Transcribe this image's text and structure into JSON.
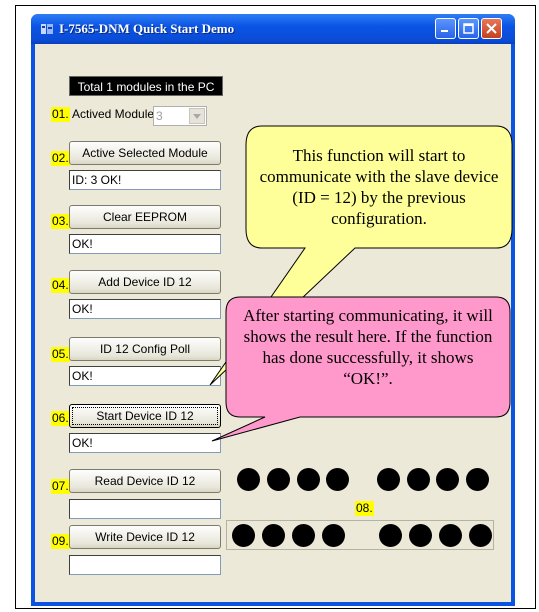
{
  "window": {
    "title": "I-7565-DNM Quick Start Demo"
  },
  "header": {
    "total_label": "Total  1  modules in the PC"
  },
  "steps": {
    "s01": {
      "num": "01.",
      "label": "Actived Module",
      "combo_value": "3"
    },
    "s02": {
      "num": "02.",
      "button": "Active Selected Module",
      "result": "ID: 3 OK!"
    },
    "s03": {
      "num": "03.",
      "button": "Clear EEPROM",
      "result": "OK!"
    },
    "s04": {
      "num": "04.",
      "button": "Add Device ID 12",
      "result": "OK!"
    },
    "s05": {
      "num": "05.",
      "button": "ID 12 Config Poll",
      "result": "OK!"
    },
    "s06": {
      "num": "06.",
      "button": "Start Device ID 12",
      "result": "OK!"
    },
    "s07": {
      "num": "07.",
      "button": "Read Device ID 12",
      "result": ""
    },
    "s08": {
      "num": "08."
    },
    "s09": {
      "num": "09.",
      "button": "Write Device ID 12",
      "result": ""
    }
  },
  "callouts": {
    "yellow": "This function will start to communicate with the slave device (ID = 12) by the previous configuration.",
    "pink": "After starting communicating, it will shows the result here. If the function has done successfully, it shows “OK!”."
  },
  "colors": {
    "title_bar": "#0b54e3",
    "highlight_num": "#ffff00",
    "yellow_callout": "#ffff99",
    "pink_callout": "#ff99cc",
    "led_off": "#000000"
  },
  "icons": [
    "app-icon",
    "minimize-icon",
    "maximize-icon",
    "close-icon",
    "dropdown-arrow-icon",
    "led-indicator"
  ]
}
